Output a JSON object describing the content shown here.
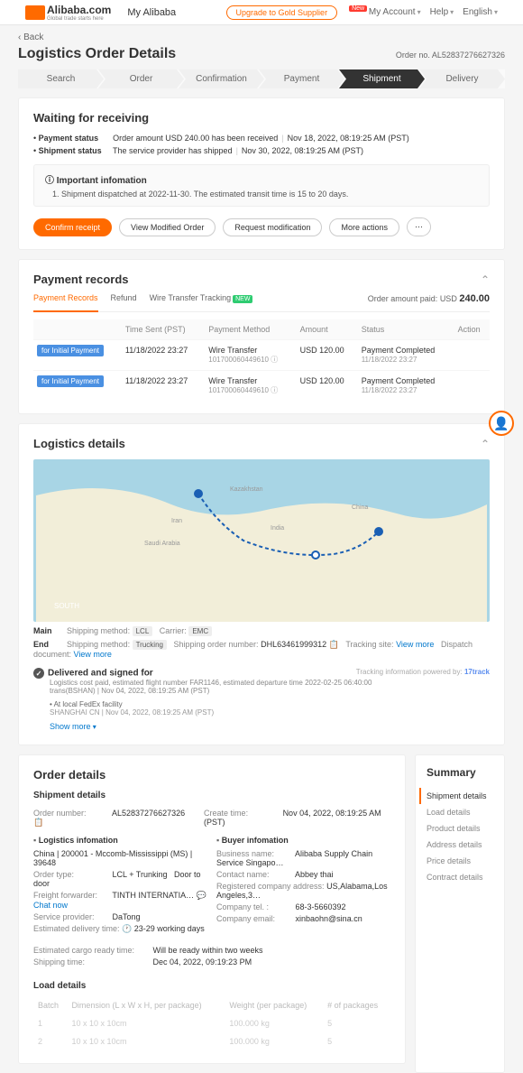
{
  "topbar": {
    "logo": "Alibaba.com",
    "tagline": "Global trade starts here",
    "nav": "My Alibaba",
    "upgrade": "Upgrade to Gold Supplier",
    "account": "My Account",
    "help": "Help",
    "lang": "English",
    "new": "New"
  },
  "back": "Back",
  "title": "Logistics Order Details",
  "orderNoLabel": "Order no.",
  "orderNo": "AL52837276627326",
  "steps": [
    "Search",
    "Order",
    "Confirmation",
    "Payment",
    "Shipment",
    "Delivery"
  ],
  "waiting": {
    "title": "Waiting for receiving",
    "payLabel": "Payment status",
    "payText": "Order amount USD 240.00 has been received",
    "payTime": "Nov 18, 2022, 08:19:25 AM (PST)",
    "shipLabel": "Shipment status",
    "shipText": "The service provider has shipped",
    "shipTime": "Nov 30, 2022, 08:19:25 AM (PST)",
    "infoTitle": "Important infomation",
    "infoItem": "1. Shipment dispatched at 2022-11-30. The estimated transit time is 15 to 20 days.",
    "btnConfirm": "Confirm receipt",
    "btnView": "View Modified Order",
    "btnRequest": "Request modification",
    "btnMore": "More actions"
  },
  "payment": {
    "title": "Payment records",
    "tab1": "Payment Records",
    "tab2": "Refund",
    "tab3": "Wire Transfer Tracking",
    "new": "NEW",
    "paidLabel": "Order amount paid:",
    "paidCur": "USD",
    "paidAmt": "240.00",
    "cols": [
      "",
      "Time Sent (PST)",
      "Payment Method",
      "Amount",
      "Status",
      "Action"
    ],
    "rows": [
      {
        "badge": "for Initial Payment",
        "time": "11/18/2022 23:27",
        "method": "Wire Transfer",
        "methodSub": "101700060449610",
        "amt": "USD 120.00",
        "status": "Payment Completed",
        "statusSub": "11/18/2022 23:27"
      },
      {
        "badge": "for Initial Payment",
        "time": "11/18/2022 23:27",
        "method": "Wire Transfer",
        "methodSub": "101700060449610",
        "amt": "USD 120.00",
        "status": "Payment Completed",
        "statusSub": "11/18/2022 23:27"
      }
    ]
  },
  "logistics": {
    "title": "Logistics details",
    "main": "Main",
    "end": "End",
    "shipMethodLbl": "Shipping method:",
    "mainMethod": "LCL",
    "carrierLbl": "Carrier:",
    "carrier": "EMC",
    "endMethod": "Trucking",
    "shipOrderLbl": "Shipping order number:",
    "shipOrder": "DHL63461999312",
    "trackSiteLbl": "Tracking site:",
    "viewMore": "View more",
    "dispatchLbl": "Dispatch document:",
    "poweredBy": "Tracking information powered by:",
    "poweredLogo": "17track",
    "trackHead": "Delivered and signed for",
    "trackSub": "Logistics cost paid, estimated flight number FAR1146, estimated departure time 2022-02-25 06:40:00",
    "trackLoc": "trans(BSHAN)  |  Nov 04, 2022, 08:19:25 AM (PST)",
    "trackItem": "At local FedEx facility",
    "trackItemLoc": "SHANGHAI CN  |  Nov 04, 2022, 08:19:25 AM (PST)",
    "showMore": "Show more"
  },
  "order": {
    "title": "Order details",
    "shipDetails": "Shipment details",
    "orderNumLbl": "Order number:",
    "orderNum": "AL52837276627326",
    "createLbl": "Create time:",
    "create": "Nov 04, 2022, 08:19:25 AM (PST)",
    "logInfoHead": "Logistics infomation",
    "buyerHead": "Buyer infomation",
    "route": "China | 200001 - Mccomb-Mississippi (MS) | 39648",
    "orderTypeLbl": "Order type:",
    "orderType": "LCL + Trunking",
    "d2d": "Door to door",
    "ffLbl": "Freight forwarder:",
    "ff": "TINTH INTERNATIA…",
    "chat": "Chat now",
    "spLbl": "Service provider:",
    "sp": "DaTong",
    "edtLbl": "Estimated delivery time:",
    "edt": "23-29 working days",
    "bizLbl": "Business name:",
    "biz": "Alibaba Supply Chain Service Singapo…",
    "contactLbl": "Contact name:",
    "contact": "Abbey thai",
    "regLbl": "Registered company address:",
    "reg": "US,Alabama,Los Angeles,3…",
    "telLbl": "Company tel. :",
    "tel": "68-3-5660392",
    "emailLbl": "Company email:",
    "email": "xinbaohn@sina.cn",
    "ecrLbl": "Estimated cargo ready time:",
    "ecr": "Will be ready within two weeks",
    "stLbl": "Shipping time:",
    "st": "Dec 04, 2022, 09:19:23 PM"
  },
  "load": {
    "title": "Load details",
    "cols": [
      "Batch",
      "Dimension (L x W x H, per package)",
      "Weight (per package)",
      "# of packages"
    ],
    "rows": [
      [
        "1",
        "10 x 10 x 10cm",
        "100.000 kg",
        "5"
      ],
      [
        "2",
        "10 x 10 x 10cm",
        "100.000 kg",
        "5"
      ]
    ]
  },
  "summary": {
    "title": "Summary",
    "items": [
      "Shipment details",
      "Load details",
      "Product details",
      "Address details",
      "Price details",
      "Contract details"
    ]
  }
}
